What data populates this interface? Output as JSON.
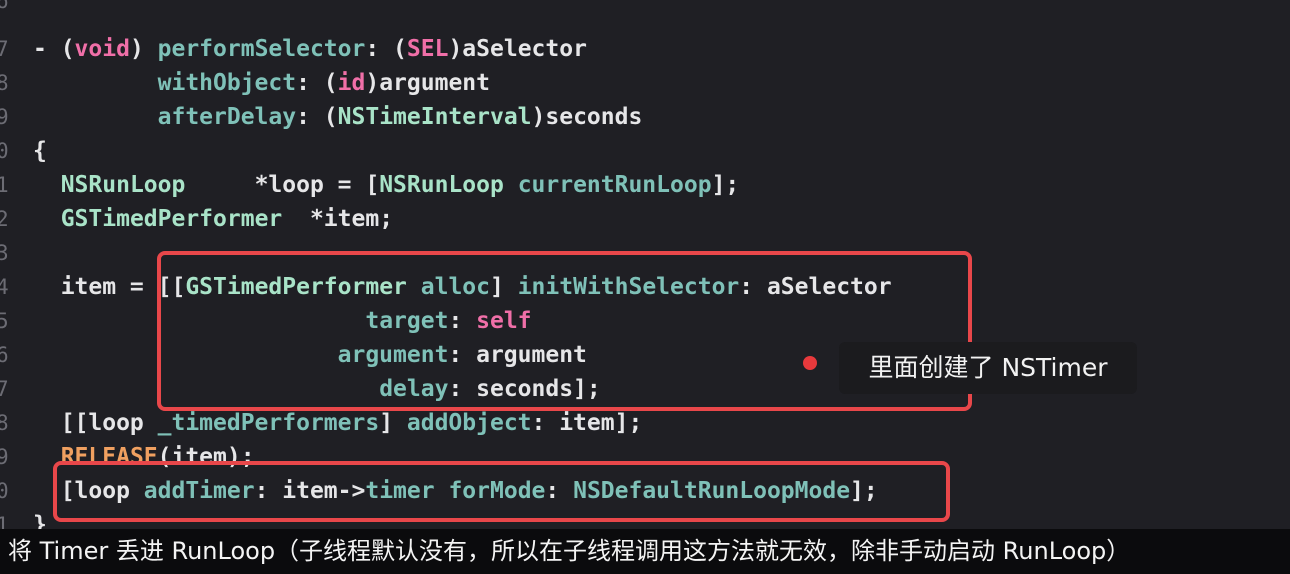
{
  "line_numbers": [
    "6",
    "7",
    "8",
    "9",
    "0",
    "1",
    "2",
    "3",
    "4",
    "5",
    "6",
    "7",
    "8",
    "9",
    "0",
    "1"
  ],
  "code": {
    "l1": [
      {
        "c": "plain",
        "t": "- ("
      },
      {
        "c": "kw",
        "t": "void"
      },
      {
        "c": "plain",
        "t": ") "
      },
      {
        "c": "method",
        "t": "performSelector"
      },
      {
        "c": "plain",
        "t": ": ("
      },
      {
        "c": "kw",
        "t": "SEL"
      },
      {
        "c": "plain",
        "t": ")aSelector"
      }
    ],
    "l2": [
      {
        "c": "plain",
        "t": "         "
      },
      {
        "c": "method",
        "t": "withObject"
      },
      {
        "c": "plain",
        "t": ": ("
      },
      {
        "c": "kw",
        "t": "id"
      },
      {
        "c": "plain",
        "t": ")argument"
      }
    ],
    "l3": [
      {
        "c": "plain",
        "t": "         "
      },
      {
        "c": "method",
        "t": "afterDelay"
      },
      {
        "c": "plain",
        "t": ": ("
      },
      {
        "c": "type",
        "t": "NSTimeInterval"
      },
      {
        "c": "plain",
        "t": ")seconds"
      }
    ],
    "l4": [
      {
        "c": "plain",
        "t": "{"
      }
    ],
    "l5": [
      {
        "c": "plain",
        "t": "  "
      },
      {
        "c": "type",
        "t": "NSRunLoop"
      },
      {
        "c": "plain",
        "t": "     *loop = ["
      },
      {
        "c": "type",
        "t": "NSRunLoop"
      },
      {
        "c": "plain",
        "t": " "
      },
      {
        "c": "method",
        "t": "currentRunLoop"
      },
      {
        "c": "plain",
        "t": "];"
      }
    ],
    "l6": [
      {
        "c": "plain",
        "t": "  "
      },
      {
        "c": "type",
        "t": "GSTimedPerformer"
      },
      {
        "c": "plain",
        "t": "  *item;"
      }
    ],
    "l7": [
      {
        "c": "plain",
        "t": ""
      }
    ],
    "l8": [
      {
        "c": "plain",
        "t": "  item = [["
      },
      {
        "c": "type",
        "t": "GSTimedPerformer"
      },
      {
        "c": "plain",
        "t": " "
      },
      {
        "c": "method",
        "t": "alloc"
      },
      {
        "c": "plain",
        "t": "] "
      },
      {
        "c": "method",
        "t": "initWithSelector"
      },
      {
        "c": "plain",
        "t": ": aSelector"
      }
    ],
    "l9": [
      {
        "c": "plain",
        "t": "                        "
      },
      {
        "c": "method",
        "t": "target"
      },
      {
        "c": "plain",
        "t": ": "
      },
      {
        "c": "kw",
        "t": "self"
      }
    ],
    "l10": [
      {
        "c": "plain",
        "t": "                      "
      },
      {
        "c": "method",
        "t": "argument"
      },
      {
        "c": "plain",
        "t": ": argument"
      }
    ],
    "l11": [
      {
        "c": "plain",
        "t": "                         "
      },
      {
        "c": "method",
        "t": "delay"
      },
      {
        "c": "plain",
        "t": ": seconds];"
      }
    ],
    "l12": [
      {
        "c": "plain",
        "t": "  [[loop "
      },
      {
        "c": "method",
        "t": "_timedPerformers"
      },
      {
        "c": "plain",
        "t": "] "
      },
      {
        "c": "method",
        "t": "addObject"
      },
      {
        "c": "plain",
        "t": ": item];"
      }
    ],
    "l13": [
      {
        "c": "plain",
        "t": "  "
      },
      {
        "c": "macro",
        "t": "RELEASE"
      },
      {
        "c": "plain",
        "t": "(item);"
      }
    ],
    "l14": [
      {
        "c": "plain",
        "t": "  [loop "
      },
      {
        "c": "method",
        "t": "addTimer"
      },
      {
        "c": "plain",
        "t": ": item->"
      },
      {
        "c": "method",
        "t": "timer"
      },
      {
        "c": "plain",
        "t": " "
      },
      {
        "c": "method",
        "t": "forMode"
      },
      {
        "c": "plain",
        "t": ": "
      },
      {
        "c": "method",
        "t": "NSDefaultRunLoopMode"
      },
      {
        "c": "plain",
        "t": "];"
      }
    ],
    "l15": [
      {
        "c": "plain",
        "t": "}"
      }
    ]
  },
  "callout": {
    "text": "里面创建了 NSTimer",
    "icon": "red-dot"
  },
  "subtitle": "将 Timer 丢进 RunLoop（子线程默认没有，所以在子线程调用这方法就无效，除非手动启动 RunLoop）",
  "colors": {
    "background": "#1f1f24",
    "keyword": "#f06fa8",
    "type": "#a9e3c8",
    "method": "#7fc1b8",
    "highlight_border": "#e8474a",
    "dot": "#e8393c"
  }
}
